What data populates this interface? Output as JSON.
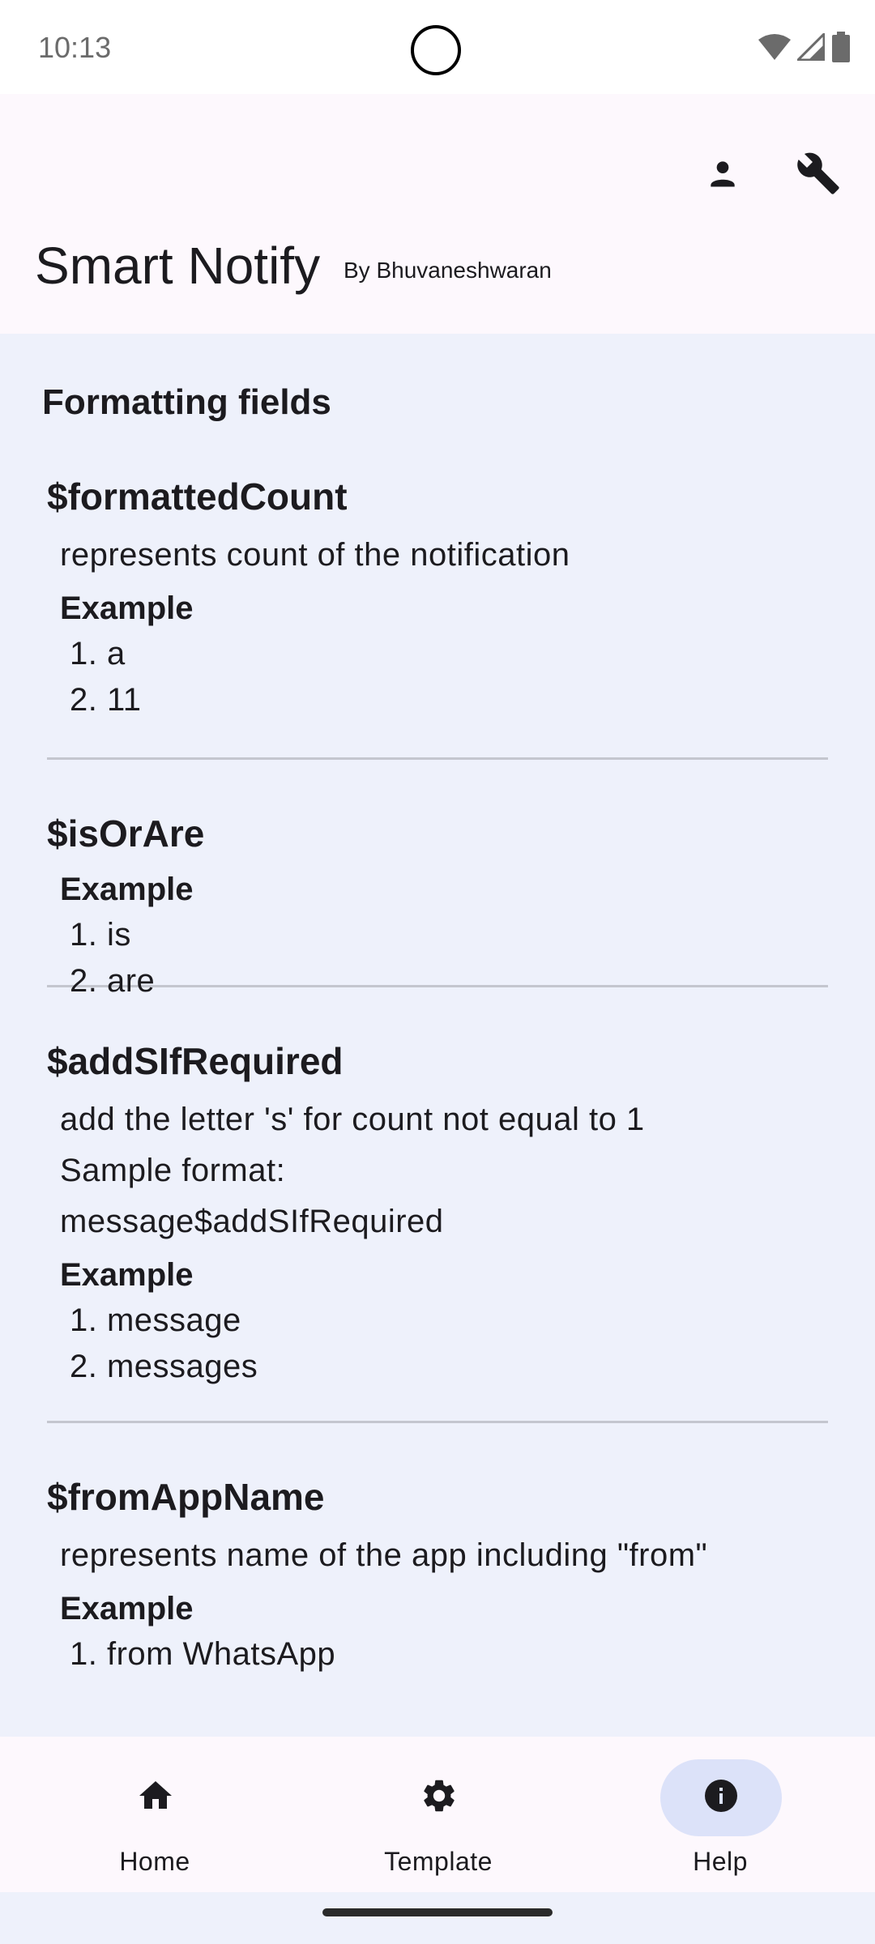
{
  "status_bar": {
    "time": "10:13",
    "icons": [
      "wifi-icon",
      "cell-signal-icon",
      "battery-icon"
    ]
  },
  "app_bar": {
    "title": "Smart Notify",
    "subtitle": "By Bhuvaneshwaran",
    "actions": [
      "account-icon",
      "wrench-icon"
    ]
  },
  "content": {
    "heading": "Formatting fields",
    "fields": [
      {
        "name": "$formattedCount",
        "description": [
          "represents count of the notification"
        ],
        "example_label": "Example",
        "examples": [
          "1. a",
          "2. 11"
        ]
      },
      {
        "name": "$isOrAre",
        "description": [],
        "example_label": "Example",
        "examples": [
          "1. is",
          "2. are"
        ]
      },
      {
        "name": "$addSIfRequired",
        "description": [
          "add the letter 's' for count not equal to 1",
          "Sample format:",
          "message$addSIfRequired"
        ],
        "example_label": "Example",
        "examples": [
          "1. message",
          "2. messages"
        ]
      },
      {
        "name": "$fromAppName",
        "description": [
          "represents name of the app including \"from\""
        ],
        "example_label": "Example",
        "examples": [
          "1. from WhatsApp"
        ]
      }
    ]
  },
  "bottom_nav": {
    "items": [
      {
        "label": "Home",
        "icon": "home-icon",
        "selected": false
      },
      {
        "label": "Template",
        "icon": "gear-icon",
        "selected": false
      },
      {
        "label": "Help",
        "icon": "info-icon",
        "selected": true
      }
    ]
  },
  "colors": {
    "app_bar_bg": "#fdf8fd",
    "content_bg": "#eef1fb",
    "selected_indicator": "#dce2f9",
    "divider": "#c4c6cf",
    "text": "#1c1b1f"
  }
}
